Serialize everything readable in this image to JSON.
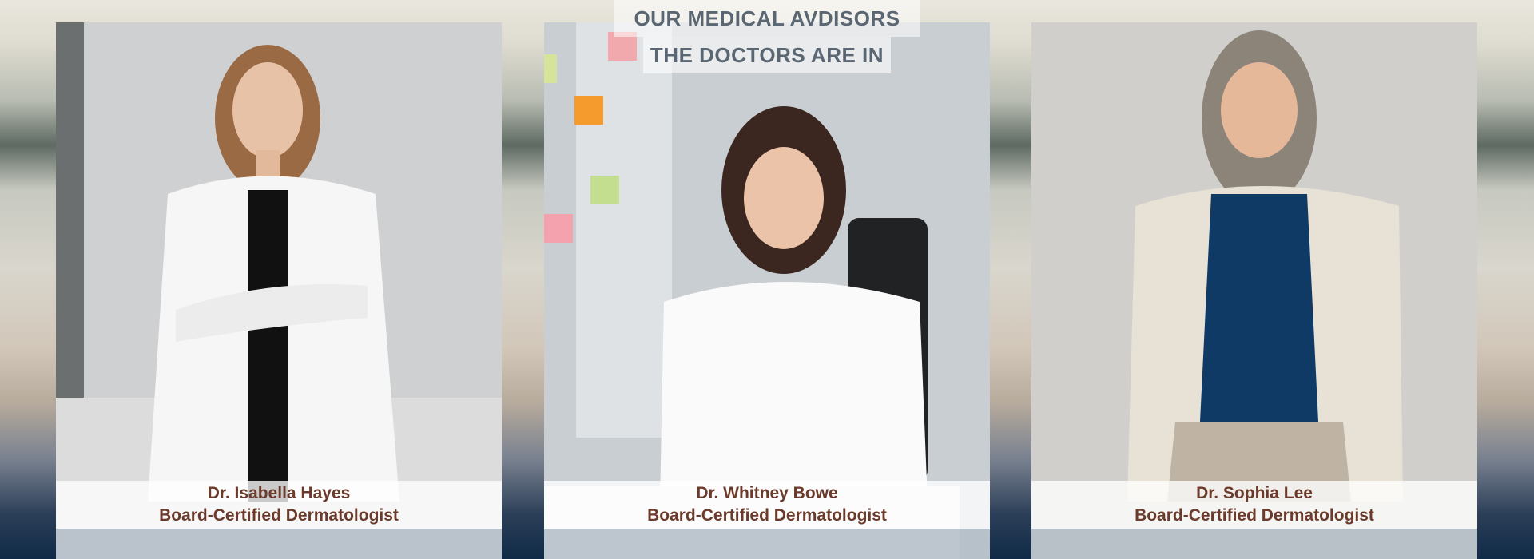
{
  "header": {
    "title": "OUR MEDICAL AVDISORS",
    "subtitle": "THE DOCTORS ARE IN"
  },
  "doctors": [
    {
      "name": "Dr. Isabella Hayes",
      "role": "Board-Certified Dermatologist"
    },
    {
      "name": "Dr. Whitney Bowe",
      "role": "Board-Certified Dermatologist"
    },
    {
      "name": "Dr. Sophia Lee",
      "role": "Board-Certified Dermatologist"
    }
  ]
}
